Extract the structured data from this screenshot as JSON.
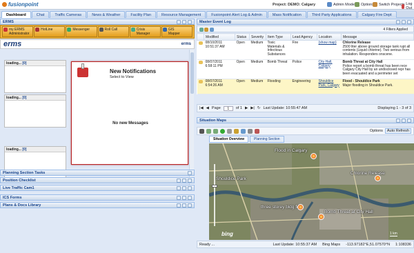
{
  "app": {
    "logo_text": "fusionpoint",
    "project_label": "Project: DEMO: Calgary",
    "top_buttons": [
      "Admin Mode",
      "Options",
      "Switch Projects",
      "Log Out"
    ]
  },
  "tabs": [
    "Dashboard",
    "Chat",
    "Traffic Cameras",
    "News & Weather",
    "Facility Plan",
    "Resource Management",
    "Fusionpoint Alert Log & Admin",
    "Mass Notification",
    "Third Party Applications",
    "Calgary Fire Dept"
  ],
  "left": {
    "erms_title": "ERMS",
    "erms_buttons": [
      {
        "label": "my ERMS",
        "sub": "Administrator",
        "icon": "user-icon"
      },
      {
        "label": "HotLine",
        "sub": "",
        "icon": "phone-icon"
      },
      {
        "label": "Messenger",
        "sub": "",
        "icon": "message-icon"
      },
      {
        "label": "Roll Call",
        "sub": "",
        "icon": "rollcall-icon"
      },
      {
        "label": "Crisis",
        "sub": "Manager",
        "icon": "crisis-icon"
      },
      {
        "label": "GIS",
        "sub": "Mapper",
        "icon": "map-icon"
      }
    ],
    "erms_logo": "erms",
    "erms_powered": "erms",
    "loading_boxes": [
      {
        "text": "loading...",
        "link": "[0]"
      },
      {
        "text": "loading...",
        "link": "[0]"
      },
      {
        "text": "loading...",
        "link": "[0]"
      }
    ],
    "notifications": {
      "title": "New Notifications",
      "subtitle": "Select to View",
      "empty": "No new Messages"
    },
    "collapsed_panels": [
      "Planning Section Tasks",
      "Position Checklist",
      "Live Traffic Cam1",
      "ICS Forms",
      "Plans & Docs Library"
    ]
  },
  "events": {
    "title": "Master Event Log",
    "filters": "4 Filters Applied",
    "columns": [
      "Modified",
      "Status",
      "Severity",
      "Item Type",
      "Lead Agency",
      "Location",
      "Message"
    ],
    "rows": [
      {
        "modified": "08/10/2011 10:51:37 AM",
        "status": "Open",
        "severity": "Medium",
        "type": "Toxic Materials & Infectious Substances",
        "agency": "Fire",
        "location": "(show map)",
        "msg_title": "Chlorine Release",
        "msg_body": "2500 liter above ground storage tank rupt all contents (Liquid chlorine). Two serious from inhalation. Responders onscene."
      },
      {
        "modified": "08/07/2011 6:58:11 PM",
        "status": "Open",
        "severity": "Medium",
        "type": "Bomb Threat",
        "agency": "Police",
        "location": "City Hall, Calgary",
        "msg_title": "Bomb Threat at City Hall",
        "msg_body": "Police report a bomb threat has been rece Calgary City Hall by an undisclosed repr has been evacuated and a perimeter set"
      },
      {
        "modified": "08/07/2011 6:54:26 AM",
        "status": "Open",
        "severity": "Medium",
        "type": "Flooding",
        "agency": "Engineering",
        "location": "Shouldice Park, Calgary",
        "msg_title": "Flood - Shouldice Park",
        "msg_body": "Major flooding in Shouldice Park."
      }
    ],
    "pager": {
      "page_label": "Page",
      "page": "1",
      "of": "of 1",
      "last_update": "Last Update: 10:55:47 AM",
      "display": "Displaying 1 - 3 of 3"
    }
  },
  "map": {
    "title": "Situation Maps",
    "options": "Options",
    "auto_refresh": "Auto Refresh",
    "tabs": [
      "Situation Overview",
      "Planning Section"
    ],
    "labels": [
      "Flood in Calgary",
      "Shouldice Park",
      "Chlorine Release",
      "three storey bldg fire",
      "Bomb Threat at City Hall"
    ],
    "bing_logo": "bing",
    "scale": "1 km",
    "footer": {
      "ready": "Ready ...",
      "last_update": "Last Update: 10:55:37 AM",
      "bing": "Bing Maps",
      "coords": "-113.97182°E,51.07570°N",
      "scale": "1:108336"
    }
  },
  "colors": {
    "accent": "#15428b",
    "erms_bar": "#f0b43c",
    "highlight_row": "#fdf6c6",
    "marker": "#e23a10"
  }
}
